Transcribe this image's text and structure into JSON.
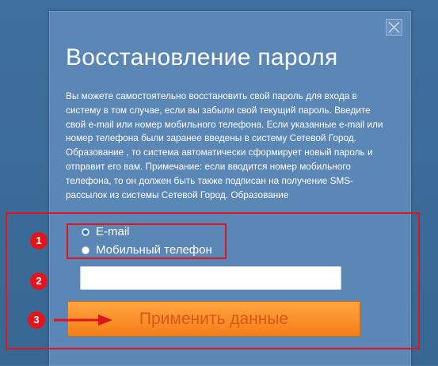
{
  "dialog": {
    "title": "Восстановление пароля",
    "description": "Вы можете самостоятельно восстановить свой пароль для входа в систему в том случае, если вы забыли свой текущий пароль. Введите свой e-mail или номер мобильного телефона. Если указанные e-mail или номер телефона были заранее введены в систему Сетевой Город. Образование , то система автоматически сформирует новый пароль и отправит его вам. Примечание: если вводится номер мобильного телефона, то он должен быть также подписан на получение SMS-рассылок из системы Сетевой Город. Образование",
    "close_icon": "close-icon"
  },
  "form": {
    "options": [
      {
        "label": "E-mail",
        "selected": true
      },
      {
        "label": "Мобильный телефон",
        "selected": false
      }
    ],
    "input_value": "",
    "input_placeholder": "",
    "submit_label": "Применить данные"
  },
  "annotations": {
    "badges": [
      "1",
      "2",
      "3"
    ],
    "highlight_color": "#e0141a"
  },
  "colors": {
    "dialog_bg": "#5b87b6",
    "button_orange": "#f57e17",
    "button_text": "#d9571a"
  }
}
